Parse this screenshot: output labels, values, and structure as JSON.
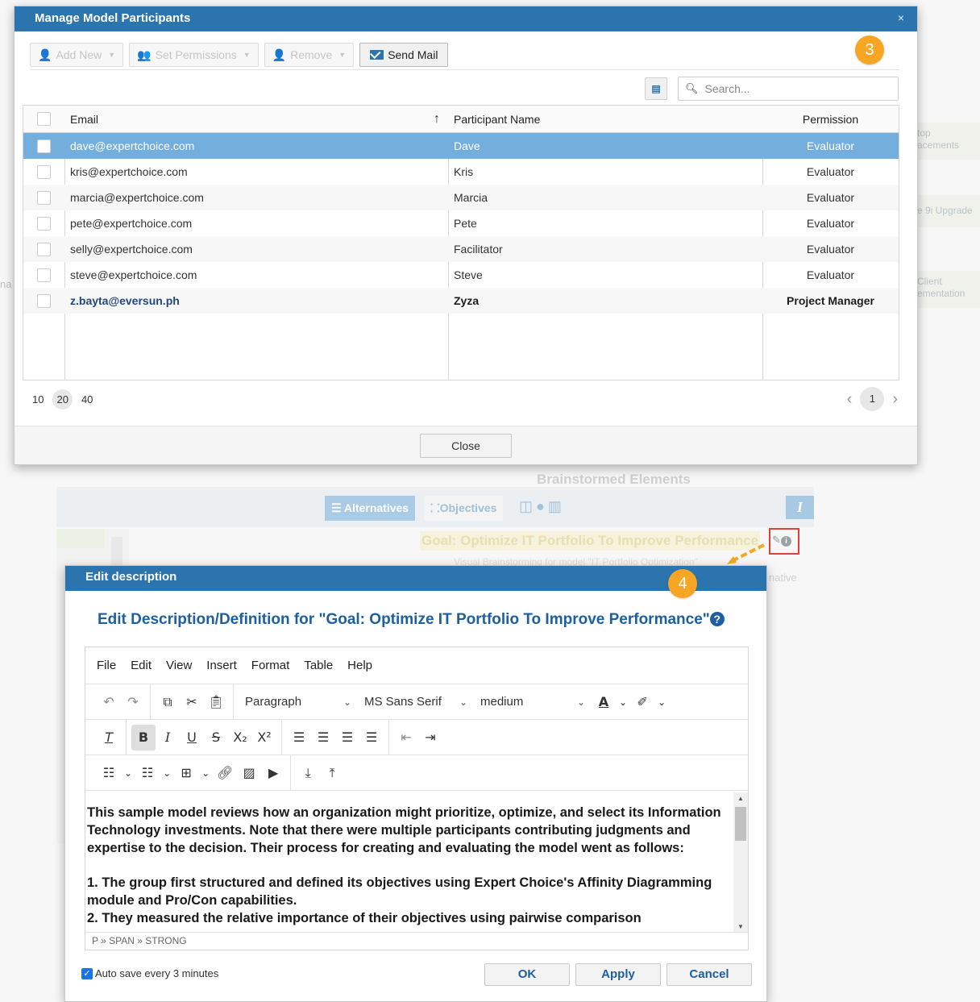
{
  "background": {
    "right_cards": [
      {
        "text": "top\nacements"
      },
      {
        "text": "e 9i Upgrade"
      },
      {
        "text": "Client\nementation"
      }
    ],
    "left_text": "na",
    "brainstorm_title": "Brainstormed Elements",
    "tabs": {
      "alternatives": "Alternatives",
      "objectives": "Objectives"
    },
    "i_button": "I",
    "goal_text": "Goal: Optimize IT Portfolio To Improve Performance",
    "goal_sub": "Visual Brainstorming for model \"IT Portfolio Optimization\"",
    "native_text": "native"
  },
  "badges": {
    "step3": "3",
    "step4": "4"
  },
  "participants_modal": {
    "title": "Manage Model Participants",
    "close_x": "×",
    "toolbar": {
      "add_new": "Add New",
      "set_permissions": "Set Permissions",
      "remove": "Remove",
      "send_mail": "Send Mail"
    },
    "search_placeholder": "Search...",
    "columns": {
      "email": "Email",
      "name": "Participant Name",
      "permission": "Permission"
    },
    "rows": [
      {
        "email": "dave@expertchoice.com",
        "name": "Dave",
        "permission": "Evaluator"
      },
      {
        "email": "kris@expertchoice.com",
        "name": "Kris",
        "permission": "Evaluator"
      },
      {
        "email": "marcia@expertchoice.com",
        "name": "Marcia",
        "permission": "Evaluator"
      },
      {
        "email": "pete@expertchoice.com",
        "name": "Pete",
        "permission": "Evaluator"
      },
      {
        "email": "selly@expertchoice.com",
        "name": "Facilitator",
        "permission": "Evaluator"
      },
      {
        "email": "steve@expertchoice.com",
        "name": "Steve",
        "permission": "Evaluator"
      },
      {
        "email": "z.bayta@eversun.ph",
        "name": "Zyza",
        "permission": "Project Manager"
      }
    ],
    "page_sizes": [
      "10",
      "20",
      "40"
    ],
    "current_page_size": "20",
    "current_page": "1",
    "close_label": "Close"
  },
  "description_modal": {
    "title": "Edit description",
    "heading": "Edit Description/Definition for \"Goal: Optimize IT Portfolio To Improve Performance\"",
    "menu": [
      "File",
      "Edit",
      "View",
      "Insert",
      "Format",
      "Table",
      "Help"
    ],
    "block_format": "Paragraph",
    "font_family": "MS Sans Serif",
    "font_size": "medium",
    "paragraphs": [
      "This sample model reviews how an organization might prioritize, optimize, and select its Information Technology investments.  Note that there were multiple participants contributing judgments and expertise to the decision.  Their process for creating and evaluating the model went as follows:",
      "1. The group first structured and defined its objectives using Expert Choice's Affinity Diagramming module and Pro/Con capabilities.\n2. They measured the relative importance of their objectives using pairwise comparison"
    ],
    "status_path": "P » SPAN » STRONG",
    "autosave_label": "Auto save every 3 minutes",
    "ok": "OK",
    "apply": "Apply",
    "cancel": "Cancel"
  }
}
